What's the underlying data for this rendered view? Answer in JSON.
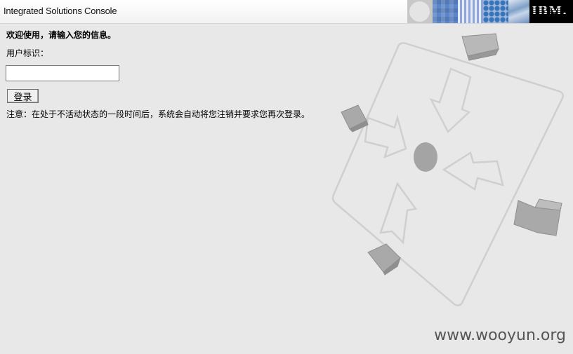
{
  "banner": {
    "title": "Integrated Solutions Console",
    "logo_text": "IBM."
  },
  "login": {
    "welcome": "欢迎使用，请输入您的信息。",
    "user_id_label": "用户标识：",
    "user_id_value": "",
    "login_button": "登录",
    "note": "注意：在处于不活动状态的一段时间后，系统会自动将您注销并要求您再次登录。"
  },
  "watermark": "www.wooyun.org",
  "colors": {
    "background": "#e8e8e8",
    "illustration_stroke": "#cfcfcf",
    "cube": "#a9a9a9"
  }
}
